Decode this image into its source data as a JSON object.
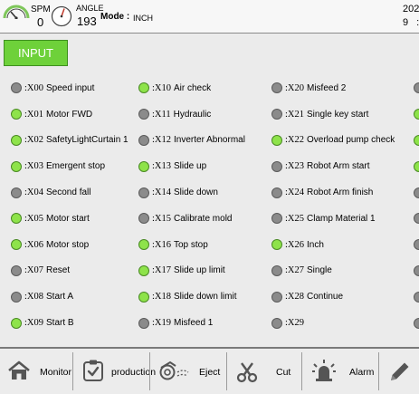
{
  "header": {
    "spm_label": "SPM",
    "spm_value": "0",
    "angle_label": "ANGLE",
    "angle_value": "193",
    "mode_label": "Mode :",
    "mode_value": "INCH",
    "date_partial": "202",
    "time_partial": "9  :"
  },
  "tab": {
    "input_label": "INPUT"
  },
  "colors": {
    "led_on": "#8ee34a",
    "led_off": "#8b8b8b",
    "tab_active": "#6ed13a"
  },
  "io": {
    "col0": [
      {
        "code": ":X00",
        "label": "Speed input",
        "on": false
      },
      {
        "code": ":X01",
        "label": "Motor FWD",
        "on": true
      },
      {
        "code": ":X02",
        "label": "SafetyLightCurtain 1",
        "on": true
      },
      {
        "code": ":X03",
        "label": "Emergent stop",
        "on": true
      },
      {
        "code": ":X04",
        "label": "Second fall",
        "on": false
      },
      {
        "code": ":X05",
        "label": "Motor start",
        "on": true
      },
      {
        "code": ":X06",
        "label": "Motor stop",
        "on": true
      },
      {
        "code": ":X07",
        "label": "Reset",
        "on": false
      },
      {
        "code": ":X08",
        "label": "Start A",
        "on": false
      },
      {
        "code": ":X09",
        "label": "Start B",
        "on": true
      }
    ],
    "col1": [
      {
        "code": ":X10",
        "label": "Air check",
        "on": true
      },
      {
        "code": ":X11",
        "label": "Hydraulic",
        "on": false
      },
      {
        "code": ":X12",
        "label": "Inverter Abnormal",
        "on": false
      },
      {
        "code": ":X13",
        "label": "Slide up",
        "on": true
      },
      {
        "code": ":X14",
        "label": "Slide down",
        "on": false
      },
      {
        "code": ":X15",
        "label": "Calibrate mold",
        "on": false
      },
      {
        "code": ":X16",
        "label": "Top stop",
        "on": true
      },
      {
        "code": ":X17",
        "label": "Slide up limit",
        "on": true
      },
      {
        "code": ":X18",
        "label": "Slide down limit",
        "on": true
      },
      {
        "code": ":X19",
        "label": "Misfeed 1",
        "on": false
      }
    ],
    "col2": [
      {
        "code": ":X20",
        "label": "Misfeed 2",
        "on": false
      },
      {
        "code": ":X21",
        "label": "Single key start",
        "on": false
      },
      {
        "code": ":X22",
        "label": "Overload pump check",
        "on": true
      },
      {
        "code": ":X23",
        "label": "Robot Arm start",
        "on": false
      },
      {
        "code": ":X24",
        "label": "Robot Arm finish",
        "on": false
      },
      {
        "code": ":X25",
        "label": "Clamp Material 1",
        "on": false
      },
      {
        "code": ":X26",
        "label": "Inch",
        "on": true
      },
      {
        "code": ":X27",
        "label": "Single",
        "on": false
      },
      {
        "code": ":X28",
        "label": "Continue",
        "on": false
      },
      {
        "code": ":X29",
        "label": "",
        "on": false
      }
    ],
    "col3": [
      {
        "on": false
      },
      {
        "on": true
      },
      {
        "on": true
      },
      {
        "on": true
      },
      {
        "on": false
      },
      {
        "on": false
      },
      {
        "on": false
      },
      {
        "on": false
      },
      {
        "on": false
      },
      {
        "on": false
      }
    ]
  },
  "nav": {
    "monitor": "Monitor",
    "production": "production",
    "eject": "Eject",
    "cut": "Cut",
    "alarm": "Alarm",
    "icons": [
      "home-icon",
      "checklist-icon",
      "eject-icon",
      "scissors-icon",
      "alarm-light-icon",
      "pencil-icon"
    ]
  }
}
